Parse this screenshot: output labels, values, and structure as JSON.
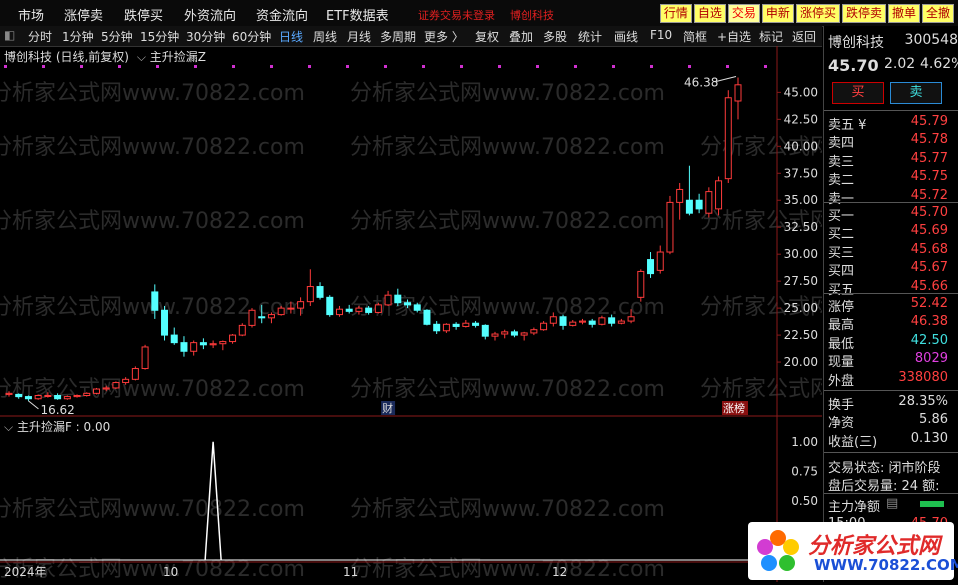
{
  "menu": [
    "市场",
    "涨停卖",
    "跌停买",
    "外资流向",
    "资金流向",
    "ETF数据表"
  ],
  "menu_red": [
    "证券交易未登录",
    "博创科技"
  ],
  "top_buttons": [
    "行情",
    "自选",
    "交易",
    "申新",
    "涨停买",
    "跌停卖",
    "撤单",
    "全撤"
  ],
  "toolbar": [
    "分时",
    "1分钟",
    "5分钟",
    "15分钟",
    "30分钟",
    "60分钟",
    "日线",
    "周线",
    "月线",
    "多周期",
    "更多 〉",
    "复权",
    "叠加",
    "多股",
    "统计",
    "画线",
    "F10",
    "简框",
    "+自选",
    "标记",
    "返回"
  ],
  "title": {
    "stock": "博创科技 (日线,前复权)",
    "indicator": "主升捡漏Z"
  },
  "sub_title": "主升捡漏F : 0.00",
  "watermark": "分析家公式网www.70822.com",
  "marks": {
    "high_label": "46.38",
    "low_label": "16.62",
    "cai": "财",
    "zhangbang": "涨榜"
  },
  "x_labels": [
    "2024年",
    "10",
    "11",
    "12"
  ],
  "panel": {
    "name": "博创科技",
    "code": "300548",
    "price": "45.70",
    "change": "2.02",
    "pct": "4.62%",
    "buy": "买",
    "sell": "卖",
    "asks": [
      {
        "k": "卖五 ¥",
        "v": "45.79"
      },
      {
        "k": "卖四",
        "v": "45.78"
      },
      {
        "k": "卖三",
        "v": "45.77"
      },
      {
        "k": "卖二",
        "v": "45.75"
      },
      {
        "k": "卖一",
        "v": "45.72"
      }
    ],
    "bids": [
      {
        "k": "买一",
        "v": "45.70"
      },
      {
        "k": "买二",
        "v": "45.69"
      },
      {
        "k": "买三",
        "v": "45.68"
      },
      {
        "k": "买四",
        "v": "45.67"
      },
      {
        "k": "买五",
        "v": "45.66"
      }
    ],
    "stats": [
      {
        "k": "涨停",
        "v": "52.42",
        "c": "up"
      },
      {
        "k": "最高",
        "v": "46.38",
        "c": "up"
      },
      {
        "k": "最低",
        "v": "42.50",
        "c": "dn"
      },
      {
        "k": "现量",
        "v": "8029",
        "c": "mg"
      },
      {
        "k": "外盘",
        "v": "338080",
        "c": "up"
      }
    ],
    "stats2": [
      {
        "k": "换手",
        "v": "28.35%",
        "c": "wt"
      },
      {
        "k": "净资",
        "v": "5.86",
        "c": "wt"
      },
      {
        "k": "收益(三)",
        "v": "0.130",
        "c": "wt"
      }
    ],
    "status": "交易状态: 闭市阶段",
    "after": "盘后交易量: 24 额:",
    "net": "主力净额",
    "time": "15:00",
    "time_px": "45.70"
  },
  "logo": {
    "text": "分析家公式网",
    "url": "WWW.70822.COM"
  },
  "chart_data": {
    "type": "candlestick",
    "main_axis": {
      "ticks": [
        45,
        42.5,
        40,
        37.5,
        35,
        32.5,
        30,
        27.5,
        25,
        22.5,
        20
      ],
      "ylim": [
        15,
        48
      ]
    },
    "sub_axis": {
      "ticks": [
        1.0,
        0.75,
        0.5
      ],
      "ylim": [
        0,
        1.1
      ]
    },
    "candles": [
      [
        17.0,
        17.3,
        16.8,
        17.1
      ],
      [
        17.0,
        17.1,
        16.6,
        16.8
      ],
      [
        16.8,
        16.9,
        16.4,
        16.6
      ],
      [
        16.6,
        17.0,
        16.5,
        16.9
      ],
      [
        16.9,
        17.2,
        16.7,
        16.9
      ],
      [
        16.9,
        17.1,
        16.5,
        16.6
      ],
      [
        16.6,
        16.9,
        16.5,
        16.8
      ],
      [
        16.8,
        17.0,
        16.7,
        16.9
      ],
      [
        16.9,
        17.2,
        16.8,
        17.1
      ],
      [
        17.1,
        17.6,
        17.0,
        17.5
      ],
      [
        17.5,
        17.8,
        17.3,
        17.6
      ],
      [
        17.6,
        18.2,
        17.5,
        18.1
      ],
      [
        18.1,
        18.6,
        17.9,
        18.4
      ],
      [
        18.4,
        19.6,
        18.3,
        19.4
      ],
      [
        19.4,
        21.6,
        19.3,
        21.4
      ],
      [
        26.5,
        27.2,
        24.0,
        24.8
      ],
      [
        24.8,
        25.2,
        22.0,
        22.5
      ],
      [
        22.5,
        23.2,
        21.6,
        21.8
      ],
      [
        21.8,
        22.4,
        20.5,
        21.0
      ],
      [
        21.0,
        22.0,
        20.6,
        21.8
      ],
      [
        21.8,
        22.2,
        21.2,
        21.6
      ],
      [
        21.6,
        22.0,
        21.3,
        21.7
      ],
      [
        21.7,
        22.0,
        21.1,
        21.9
      ],
      [
        21.9,
        22.6,
        21.7,
        22.5
      ],
      [
        22.5,
        23.6,
        22.4,
        23.4
      ],
      [
        23.4,
        25.0,
        23.2,
        24.8
      ],
      [
        24.2,
        25.3,
        23.6,
        24.1
      ],
      [
        24.1,
        24.6,
        23.6,
        24.4
      ],
      [
        24.4,
        25.2,
        24.3,
        25.0
      ],
      [
        25.0,
        25.6,
        24.5,
        25.0
      ],
      [
        25.0,
        26.0,
        24.3,
        25.6
      ],
      [
        25.6,
        28.6,
        25.2,
        27.0
      ],
      [
        27.0,
        27.4,
        25.8,
        26.0
      ],
      [
        26.0,
        26.2,
        24.2,
        24.4
      ],
      [
        24.4,
        25.2,
        24.2,
        24.9
      ],
      [
        24.9,
        25.3,
        24.5,
        24.7
      ],
      [
        24.7,
        25.2,
        24.4,
        25.0
      ],
      [
        25.0,
        25.2,
        24.4,
        24.6
      ],
      [
        24.6,
        25.5,
        24.5,
        25.3
      ],
      [
        25.3,
        26.6,
        25.2,
        26.2
      ],
      [
        26.2,
        26.8,
        25.2,
        25.5
      ],
      [
        25.5,
        25.8,
        25.0,
        25.3
      ],
      [
        25.3,
        25.5,
        24.6,
        24.8
      ],
      [
        24.8,
        24.9,
        23.4,
        23.5
      ],
      [
        23.5,
        23.8,
        22.6,
        22.9
      ],
      [
        22.9,
        23.6,
        22.7,
        23.5
      ],
      [
        23.5,
        23.7,
        23.0,
        23.3
      ],
      [
        23.3,
        23.9,
        23.2,
        23.6
      ],
      [
        23.6,
        23.8,
        23.2,
        23.4
      ],
      [
        23.4,
        23.5,
        22.1,
        22.4
      ],
      [
        22.4,
        22.8,
        22.0,
        22.6
      ],
      [
        22.6,
        23.0,
        22.2,
        22.8
      ],
      [
        22.8,
        23.0,
        22.3,
        22.5
      ],
      [
        22.5,
        22.8,
        22.0,
        22.7
      ],
      [
        22.7,
        23.2,
        22.5,
        23.0
      ],
      [
        23.0,
        23.8,
        22.9,
        23.6
      ],
      [
        23.6,
        24.6,
        23.3,
        24.2
      ],
      [
        24.2,
        24.4,
        23.0,
        23.4
      ],
      [
        23.4,
        23.9,
        23.3,
        23.7
      ],
      [
        23.7,
        24.0,
        23.5,
        23.8
      ],
      [
        23.8,
        24.0,
        23.2,
        23.5
      ],
      [
        23.5,
        24.3,
        23.4,
        24.1
      ],
      [
        24.1,
        24.4,
        23.3,
        23.6
      ],
      [
        23.6,
        24.0,
        23.5,
        23.8
      ],
      [
        23.8,
        24.9,
        23.6,
        24.2
      ],
      [
        26.0,
        28.6,
        25.6,
        28.4
      ],
      [
        29.5,
        30.2,
        27.8,
        28.2
      ],
      [
        28.5,
        30.8,
        28.2,
        30.2
      ],
      [
        30.2,
        35.4,
        30.0,
        34.8
      ],
      [
        34.8,
        36.6,
        33.2,
        36.0
      ],
      [
        35.0,
        38.2,
        33.6,
        33.8
      ],
      [
        35.0,
        35.6,
        33.8,
        34.2
      ],
      [
        33.8,
        36.2,
        33.4,
        35.8
      ],
      [
        34.2,
        37.2,
        33.6,
        36.8
      ],
      [
        37.0,
        45.2,
        36.6,
        44.5
      ],
      [
        44.2,
        46.38,
        42.5,
        45.7
      ]
    ],
    "signal": [
      {
        "bar": 21,
        "value": 1.0
      }
    ]
  }
}
